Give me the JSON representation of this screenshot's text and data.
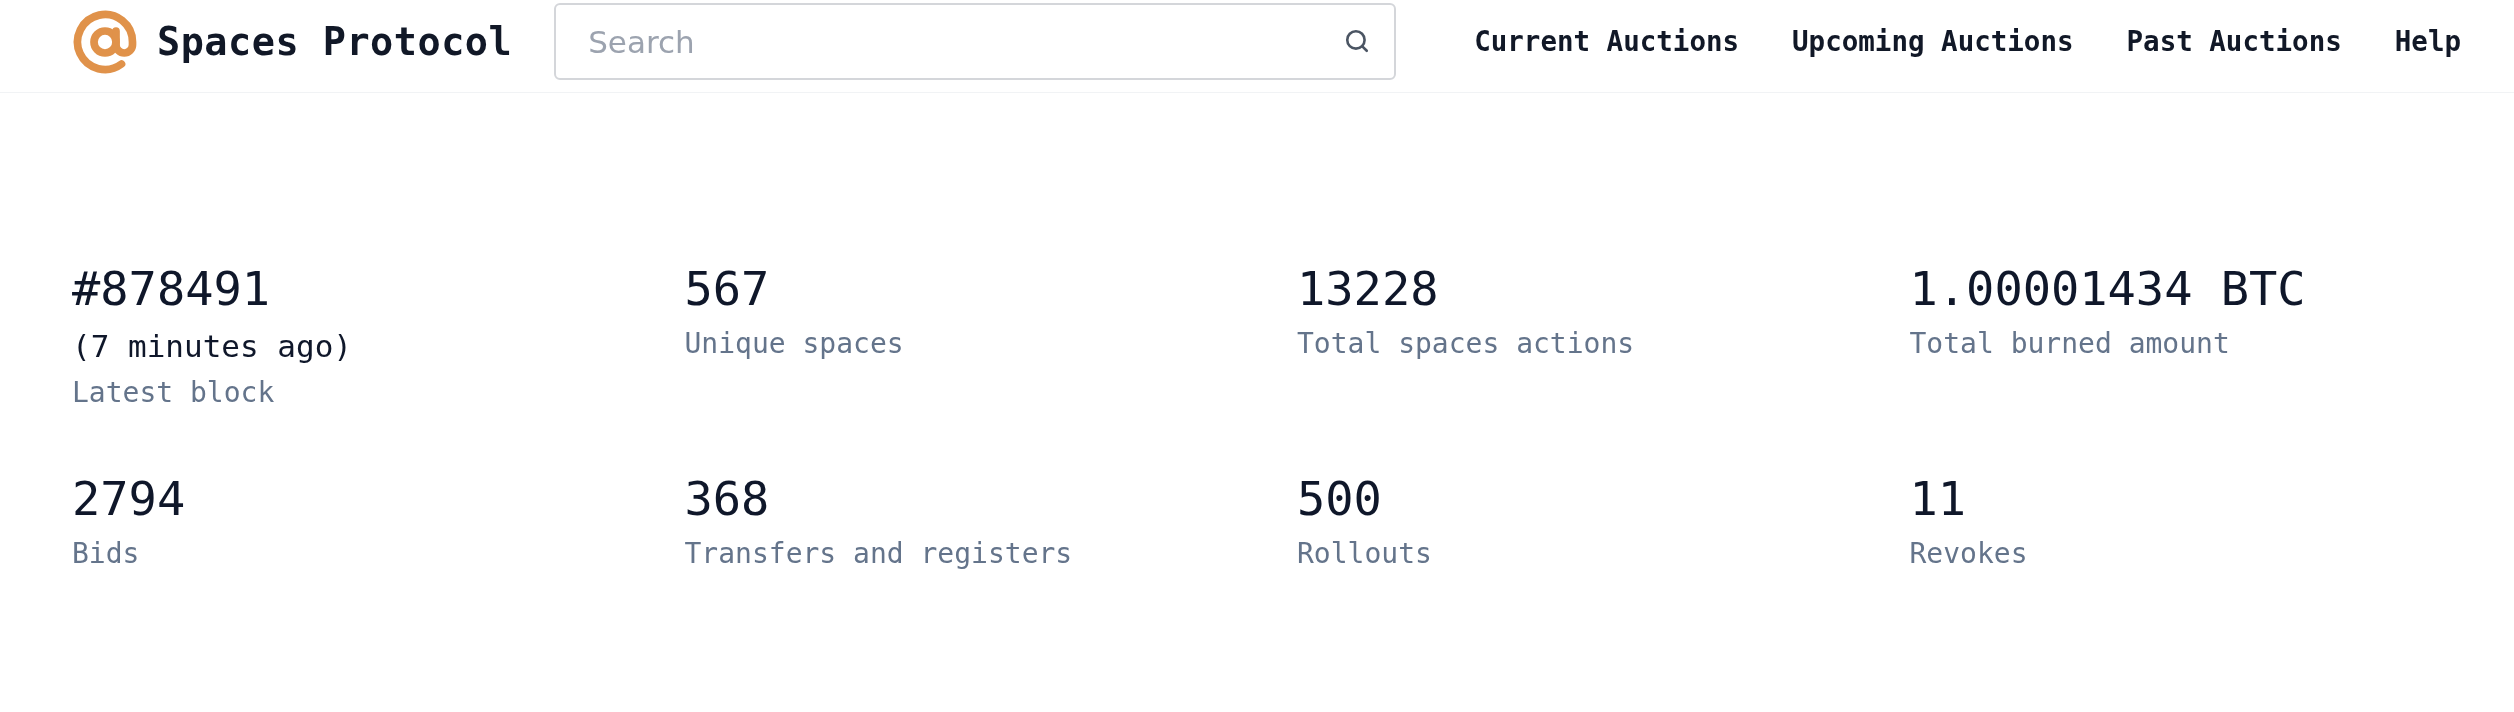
{
  "header": {
    "title": "Spaces Protocol",
    "search": {
      "placeholder": "Search"
    },
    "nav": [
      "Current Auctions",
      "Upcoming Auctions",
      "Past Auctions",
      "Help"
    ]
  },
  "stats": [
    {
      "value": "#878491",
      "detail": "(7 minutes ago)",
      "label": "Latest block"
    },
    {
      "value": "567",
      "label": "Unique spaces"
    },
    {
      "value": "13228",
      "label": "Total spaces actions"
    },
    {
      "value": "1.00001434 BTC",
      "label": "Total burned amount"
    },
    {
      "value": "2794",
      "label": "Bids"
    },
    {
      "value": "368",
      "label": "Transfers and registers"
    },
    {
      "value": "500",
      "label": "Rollouts"
    },
    {
      "value": "11",
      "label": "Revokes"
    }
  ]
}
